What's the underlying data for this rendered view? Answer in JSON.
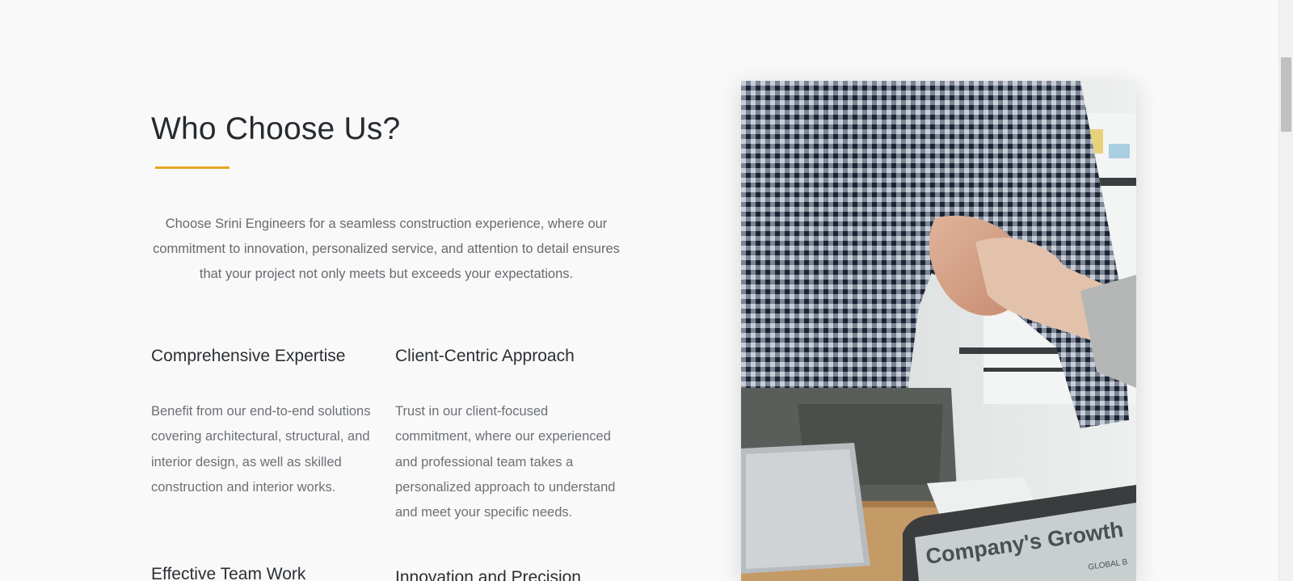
{
  "section": {
    "title": "Who Choose Us?",
    "accent_color": "#e8a823",
    "intro": "Choose Srini Engineers for a seamless construction experience, where our commitment to innovation, personalized service, and attention to detail ensures that your project not only meets but exceeds your expectations."
  },
  "features": [
    {
      "title": "Comprehensive Expertise",
      "text": "Benefit from our end-to-end solutions covering architectural, structural, and interior design, as well as skilled construction and interior works."
    },
    {
      "title": "Client-Centric Approach",
      "text": "Trust in our client-focused commitment, where our experienced and professional team takes a personalized approach to understand and meet your specific needs."
    },
    {
      "title": "Effective Team Work",
      "text": ""
    },
    {
      "title": "Innovation and Precision",
      "text": ""
    }
  ],
  "photo": {
    "laptop_text": "Company's Growth",
    "laptop_subtext": "GLOBAL B"
  }
}
